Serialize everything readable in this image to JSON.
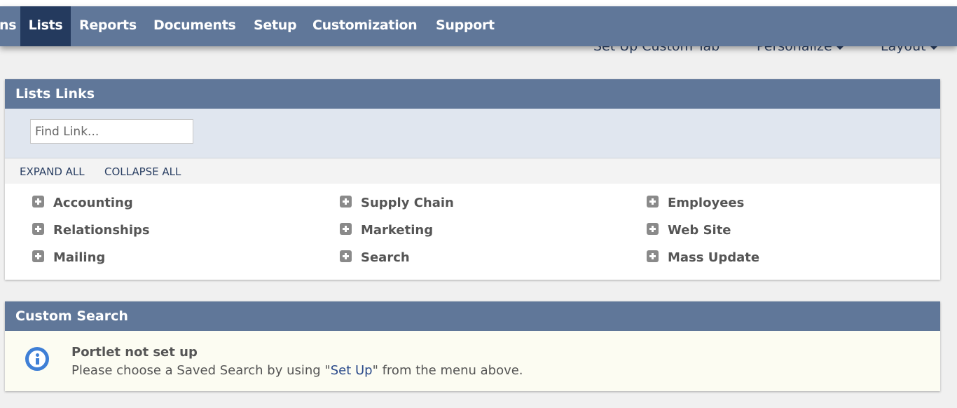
{
  "nav": {
    "items": [
      {
        "label": "ns"
      },
      {
        "label": "Lists"
      },
      {
        "label": "Reports"
      },
      {
        "label": "Documents"
      },
      {
        "label": "Setup"
      },
      {
        "label": "Customization"
      },
      {
        "label": "Support"
      }
    ],
    "active": "Lists"
  },
  "subbar": {
    "custom_tab": "Set Up Custom Tab",
    "personalize": "Personalize",
    "layout": "Layout"
  },
  "lists_links": {
    "title": "Lists Links",
    "find_placeholder": "Find Link...",
    "expand_all": "EXPAND ALL",
    "collapse_all": "COLLAPSE ALL",
    "columns": [
      [
        "Accounting",
        "Relationships",
        "Mailing"
      ],
      [
        "Supply Chain",
        "Marketing",
        "Search"
      ],
      [
        "Employees",
        "Web Site",
        "Mass Update"
      ]
    ]
  },
  "custom_search": {
    "title": "Custom Search",
    "message_title": "Portlet not set up",
    "message_before": "Please choose a Saved Search by using \"",
    "message_link": "Set Up",
    "message_after": "\" from the menu above."
  },
  "colors": {
    "nav_bg": "#607799",
    "nav_active": "#243a5e",
    "link_text": "#2a3f63",
    "info_blue": "#3f7fd6"
  }
}
